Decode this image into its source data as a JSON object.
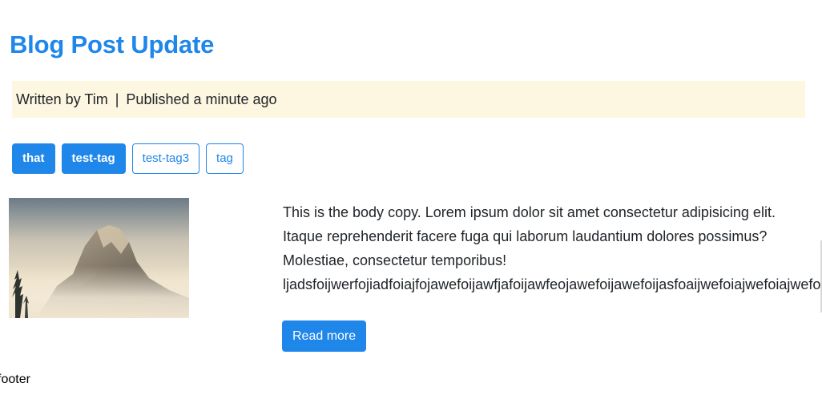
{
  "post": {
    "title": "Blog Post Update",
    "author_text": "Written by Tim",
    "separator": "|",
    "published_text": "Published a minute ago",
    "tags": [
      {
        "label": "that",
        "style": "solid"
      },
      {
        "label": "test-tag",
        "style": "solid"
      },
      {
        "label": "test-tag3",
        "style": "outline"
      },
      {
        "label": "tag",
        "style": "outline"
      }
    ],
    "image_alt": "mountain-landscape",
    "body_lines": [
      "This is the body copy. Lorem ipsum dolor sit amet consectetur adipisicing elit.",
      "Itaque reprehenderit facere fuga qui laborum laudantium dolores possimus?",
      "Molestiae, consectetur temporibus!",
      "ljadsfoijwerfojiadfoiajfojawefoijawfjafoijawfeojawefoijawefoijasfoaijwefoiajwefoiajwefoijawefoijawefoijawefoijawef"
    ],
    "read_more_label": "Read more"
  },
  "footer": {
    "text": "footer"
  },
  "colors": {
    "accent": "#1f86ea",
    "byline_bg": "#fdf6e1",
    "text": "#212529"
  }
}
